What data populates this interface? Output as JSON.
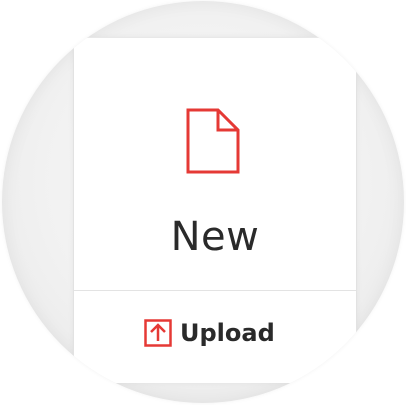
{
  "colors": {
    "accent": "#e53935",
    "text": "#2a2a2a",
    "background": "#f3f3f3",
    "card": "#ffffff"
  },
  "new_tile": {
    "label": "New",
    "icon": "document-icon"
  },
  "upload_tile": {
    "label": "Upload",
    "icon": "upload-icon"
  }
}
